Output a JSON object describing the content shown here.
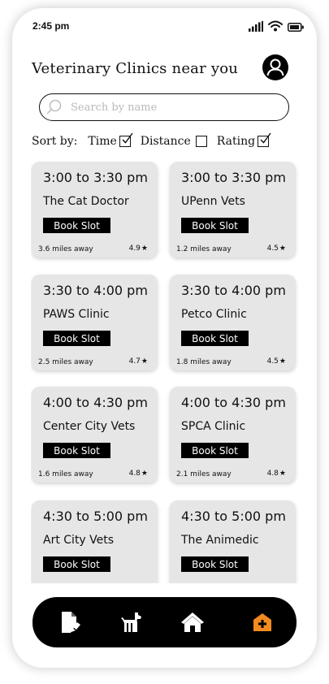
{
  "status": {
    "time": "2:45 pm"
  },
  "header": {
    "title": "Veterinary Clinics near you"
  },
  "search": {
    "placeholder": "Search by name"
  },
  "sort": {
    "label": "Sort by:",
    "options": [
      {
        "label": "Time",
        "checked": true
      },
      {
        "label": "Distance",
        "checked": false
      },
      {
        "label": "Rating",
        "checked": true
      }
    ]
  },
  "clinics": [
    {
      "time": "3:00 to 3:30 pm",
      "name": "The Cat Doctor",
      "button": "Book Slot",
      "distance": "3.6 miles away",
      "rating": "4.9"
    },
    {
      "time": "3:00 to 3:30 pm",
      "name": "UPenn Vets",
      "button": "Book Slot",
      "distance": "1.2 miles away",
      "rating": "4.5"
    },
    {
      "time": "3:30 to 4:00 pm",
      "name": "PAWS Clinic",
      "button": "Book Slot",
      "distance": "2.5 miles away",
      "rating": "4.7"
    },
    {
      "time": "3:30 to 4:00 pm",
      "name": "Petco Clinic",
      "button": "Book Slot",
      "distance": "1.8 miles away",
      "rating": "4.5"
    },
    {
      "time": "4:00 to 4:30 pm",
      "name": "Center City Vets",
      "button": "Book Slot",
      "distance": "1.6 miles away",
      "rating": "4.8"
    },
    {
      "time": "4:00 to 4:30 pm",
      "name": "SPCA Clinic",
      "button": "Book Slot",
      "distance": "2.1 miles away",
      "rating": "4.8"
    },
    {
      "time": "4:30 to 5:00 pm",
      "name": "Art City Vets",
      "button": "Book Slot",
      "distance": "",
      "rating": ""
    },
    {
      "time": "4:30 to 5:00 pm",
      "name": "The Animedic",
      "button": "Book Slot",
      "distance": "",
      "rating": ""
    }
  ],
  "nav": {
    "items": [
      "records-icon",
      "dog-icon",
      "home-icon",
      "clinic-icon"
    ],
    "active": "clinic-icon",
    "active_color": "#f28a1e"
  }
}
